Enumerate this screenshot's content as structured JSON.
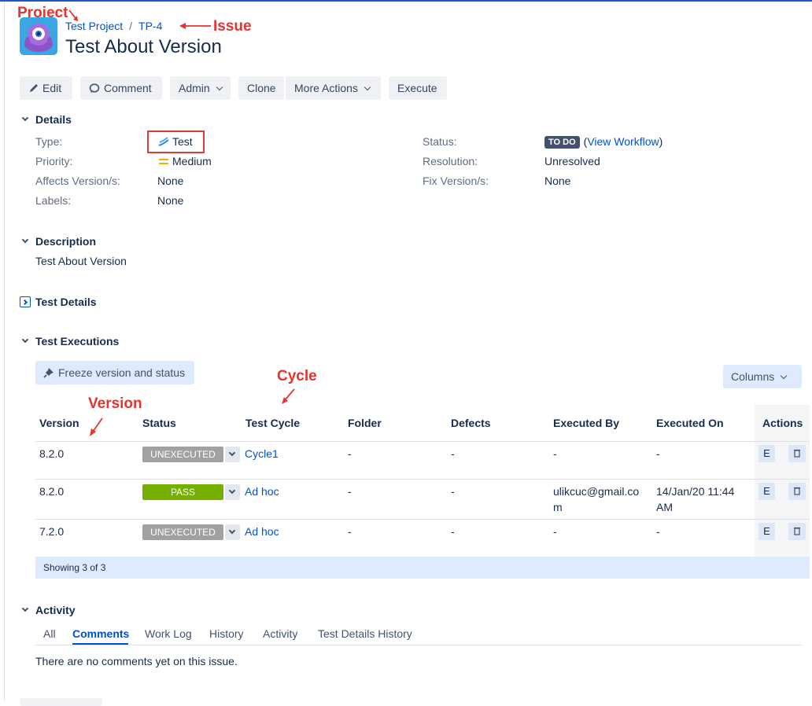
{
  "annotations": {
    "project": "Project",
    "issue": "Issue",
    "cycle": "Cycle",
    "version": "Version"
  },
  "header": {
    "project": "Test Project",
    "separator": "/",
    "issue_key": "TP-4",
    "title": "Test About Version"
  },
  "toolbar": {
    "edit": "Edit",
    "comment": "Comment",
    "admin": "Admin",
    "clone": "Clone",
    "more_actions": "More Actions",
    "execute": "Execute"
  },
  "details": {
    "heading": "Details",
    "type_label": "Type:",
    "type_value": "Test",
    "priority_label": "Priority:",
    "priority_value": "Medium",
    "affects_label": "Affects Version/s:",
    "affects_value": "None",
    "labels_label": "Labels:",
    "labels_value": "None",
    "status_label": "Status:",
    "status_badge": "TO DO",
    "status_link_open": "(",
    "status_link": "View Workflow",
    "status_link_close": ")",
    "resolution_label": "Resolution:",
    "resolution_value": "Unresolved",
    "fix_label": "Fix Version/s:",
    "fix_value": "None"
  },
  "description": {
    "heading": "Description",
    "text": "Test About Version"
  },
  "test_details": {
    "heading": "Test Details"
  },
  "executions": {
    "heading": "Test Executions",
    "freeze_label": "Freeze version and status",
    "columns_label": "Columns",
    "headers": [
      "Version",
      "Status",
      "Test Cycle",
      "Folder",
      "Defects",
      "Executed By",
      "Executed On",
      "Actions"
    ],
    "rows": [
      {
        "version": "8.2.0",
        "status": "UNEXECUTED",
        "cycle": "Cycle1",
        "folder": "-",
        "defects": "-",
        "executed_by_1": "-",
        "executed_by_2": "",
        "executed_on_1": "-",
        "executed_on_2": "",
        "action_e": "E"
      },
      {
        "version": "8.2.0",
        "status": "PASS",
        "cycle": "Ad hoc",
        "folder": "-",
        "defects": "-",
        "executed_by_1": "ulikcuc@gmail.co",
        "executed_by_2": "m",
        "executed_on_1": "14/Jan/20 11:44",
        "executed_on_2": "AM",
        "action_e": "E"
      },
      {
        "version": "7.2.0",
        "status": "UNEXECUTED",
        "cycle": "Ad hoc",
        "folder": "-",
        "defects": "-",
        "executed_by_1": "-",
        "executed_by_2": "",
        "executed_on_1": "-",
        "executed_on_2": "",
        "action_e": "E"
      }
    ],
    "showing": "Showing 3 of 3"
  },
  "activity": {
    "heading": "Activity",
    "tabs": [
      "All",
      "Comments",
      "Work Log",
      "History",
      "Activity",
      "Test Details History"
    ],
    "empty_text": "There are no comments yet on this issue."
  },
  "colors": {
    "link": "#0052cc",
    "pass": "#75b000",
    "unexecuted": "#a1a1a1",
    "annotation": "#e8322d"
  }
}
